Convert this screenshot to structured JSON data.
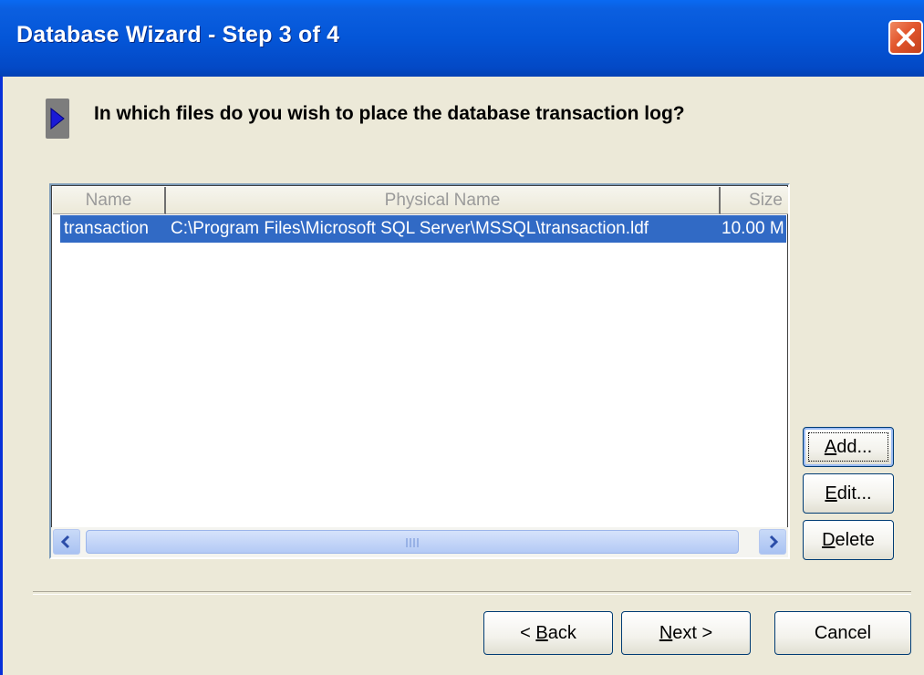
{
  "window": {
    "title": "Database Wizard - Step 3 of 4"
  },
  "question": "In which files do you wish to place the database transaction log?",
  "table": {
    "columns": [
      "Name",
      "Physical Name",
      "Size"
    ],
    "rows": [
      {
        "name": "transaction",
        "physical_name": "C:\\Program Files\\Microsoft SQL Server\\MSSQL\\transaction.ldf",
        "size": "10.00 M"
      }
    ]
  },
  "side_buttons": {
    "add": {
      "mnemonic": "A",
      "rest": "dd..."
    },
    "edit": {
      "mnemonic": "E",
      "rest": "dit..."
    },
    "delete": {
      "mnemonic": "D",
      "rest": "elete"
    }
  },
  "footer_buttons": {
    "back": {
      "prefix": "< ",
      "mnemonic": "B",
      "rest": "ack"
    },
    "next": {
      "mnemonic": "N",
      "rest": "ext >"
    },
    "cancel": "Cancel"
  },
  "colors": {
    "title_bar": "#0456d8",
    "selection": "#316ac5",
    "dialog_bg": "#ece9d8",
    "close": "#e2562d"
  },
  "icons": {
    "close": "close-x-icon",
    "step_marker": "blue-arrow-icon",
    "scroll_left": "arrow-left-icon",
    "scroll_right": "arrow-right-icon",
    "grip": "scroll-grip-icon"
  }
}
